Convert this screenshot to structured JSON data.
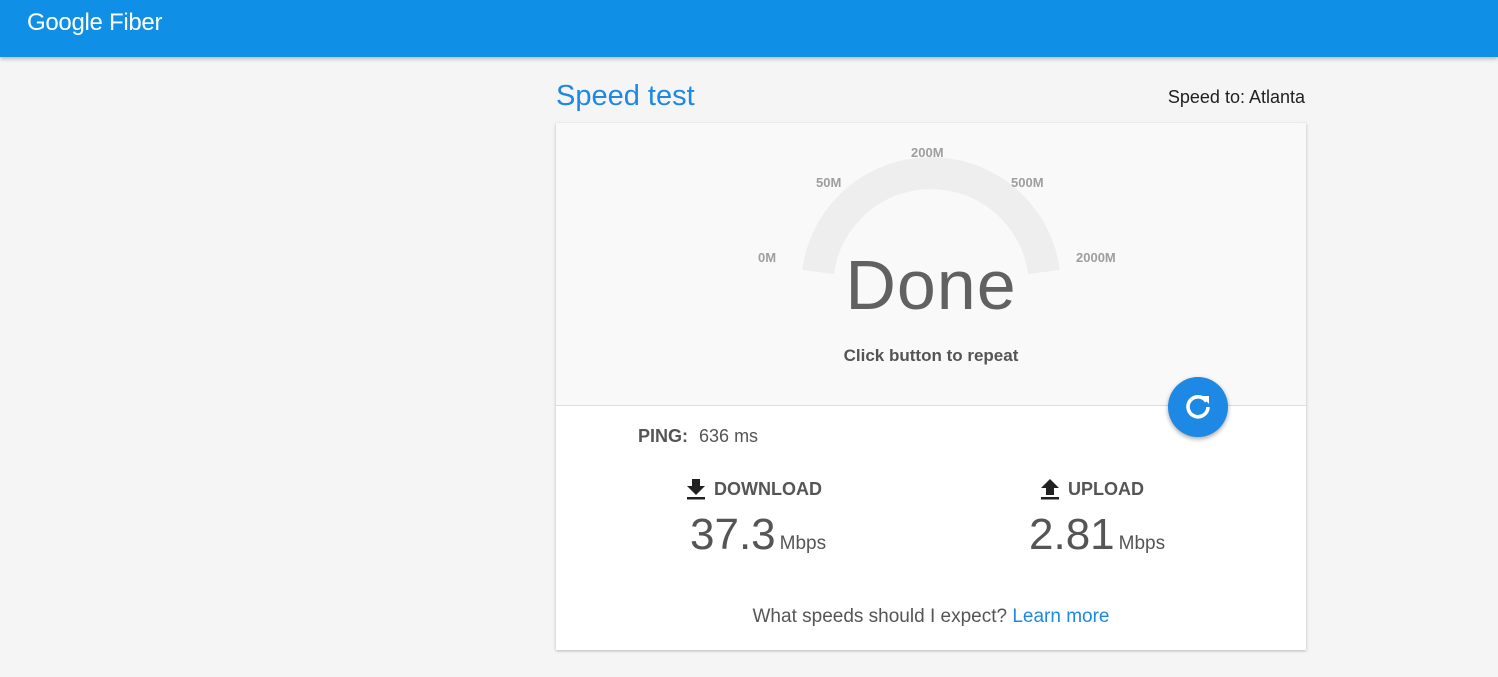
{
  "header": {
    "brand": "Google Fiber"
  },
  "page": {
    "title": "Speed test",
    "speed_to": "Speed to: Atlanta"
  },
  "gauge": {
    "ticks": [
      "0M",
      "50M",
      "200M",
      "500M",
      "2000M"
    ],
    "status": "Done",
    "hint": "Click button to repeat",
    "repeat_icon": "refresh-icon"
  },
  "results": {
    "ping_label": "PING:",
    "ping_value": "636 ms",
    "download_label": "DOWNLOAD",
    "download_value": "37.3",
    "download_unit": "Mbps",
    "download_icon": "download-icon",
    "upload_label": "UPLOAD",
    "upload_value": "2.81",
    "upload_unit": "Mbps",
    "upload_icon": "upload-icon"
  },
  "footer": {
    "question": "What speeds should I expect?",
    "link": "Learn more"
  },
  "colors": {
    "brand_blue": "#0f8fe6",
    "accent": "#1e88e5",
    "gauge_track": "#eeeeee"
  }
}
